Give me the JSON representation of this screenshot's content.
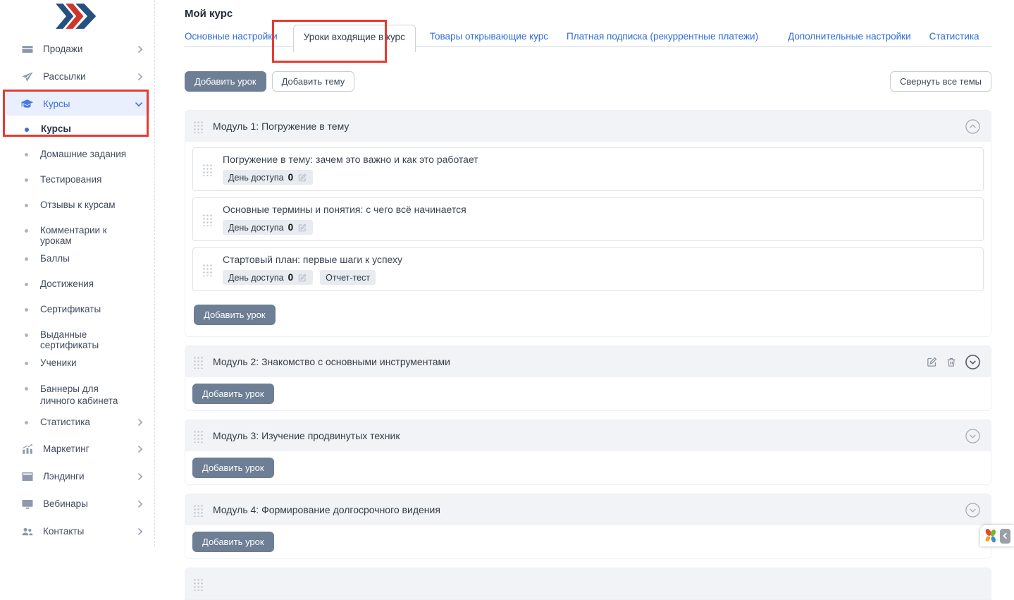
{
  "annotation_color": "#e63a33",
  "sidebar": {
    "items": [
      {
        "label": "Продажи",
        "icon": "credit-card-icon"
      },
      {
        "label": "Рассылки",
        "icon": "paper-plane-icon"
      },
      {
        "label": "Курсы",
        "icon": "graduation-cap-icon",
        "active": true,
        "expanded": true
      }
    ],
    "sub_items": [
      {
        "label": "Курсы",
        "active": true
      },
      {
        "label": "Домашние задания"
      },
      {
        "label": "Тестирования"
      },
      {
        "label": "Отзывы к курсам"
      },
      {
        "label": "Комментарии к урокам"
      },
      {
        "label": "Баллы"
      },
      {
        "label": "Достижения"
      },
      {
        "label": "Сертификаты"
      },
      {
        "label": "Выданные сертификаты"
      },
      {
        "label": "Ученики"
      },
      {
        "label": "Баннеры для личного кабинета"
      },
      {
        "label": "Статистика",
        "has_submenu": true
      }
    ],
    "bottom_items": [
      {
        "label": "Маркетинг",
        "icon": "bar-chart-icon"
      },
      {
        "label": "Лэндинги",
        "icon": "browser-icon"
      },
      {
        "label": "Вебинары",
        "icon": "monitor-icon"
      },
      {
        "label": "Контакты",
        "icon": "users-icon"
      }
    ]
  },
  "header": {
    "title": "Мой курс",
    "tabs": [
      {
        "label": "Основные настройки"
      },
      {
        "label": "Уроки входящие в курс",
        "active": true
      },
      {
        "label": "Товары открывающие курс"
      },
      {
        "label": "Платная подписка (рекуррентные платежи)"
      },
      {
        "label": "Дополнительные настройки"
      },
      {
        "label": "Статистика"
      }
    ]
  },
  "toolbar": {
    "add_lesson": "Добавить урок",
    "add_theme": "Добавить тему",
    "collapse_all": "Свернуть все темы"
  },
  "labels": {
    "access_day": "День доступа",
    "access_value": "0",
    "report_test": "Отчет-тест",
    "add_lesson": "Добавить урок"
  },
  "modules": [
    {
      "title": "Модуль 1: Погружение в тему",
      "expanded": true,
      "lessons": [
        {
          "title": "Погружение в тему: зачем это важно и как это работает"
        },
        {
          "title": "Основные термины и понятия: с чего всё начинается"
        },
        {
          "title": "Стартовый план: первые шаги к успеху",
          "extra_badge": "Отчет-тест"
        }
      ]
    },
    {
      "title": "Модуль 2: Знакомство с основными инструментами",
      "expanded": false
    },
    {
      "title": "Модуль 3: Изучение продвинутых техник",
      "expanded": false
    },
    {
      "title": "Модуль 4: Формирование долгосрочного видения",
      "expanded": false
    }
  ]
}
